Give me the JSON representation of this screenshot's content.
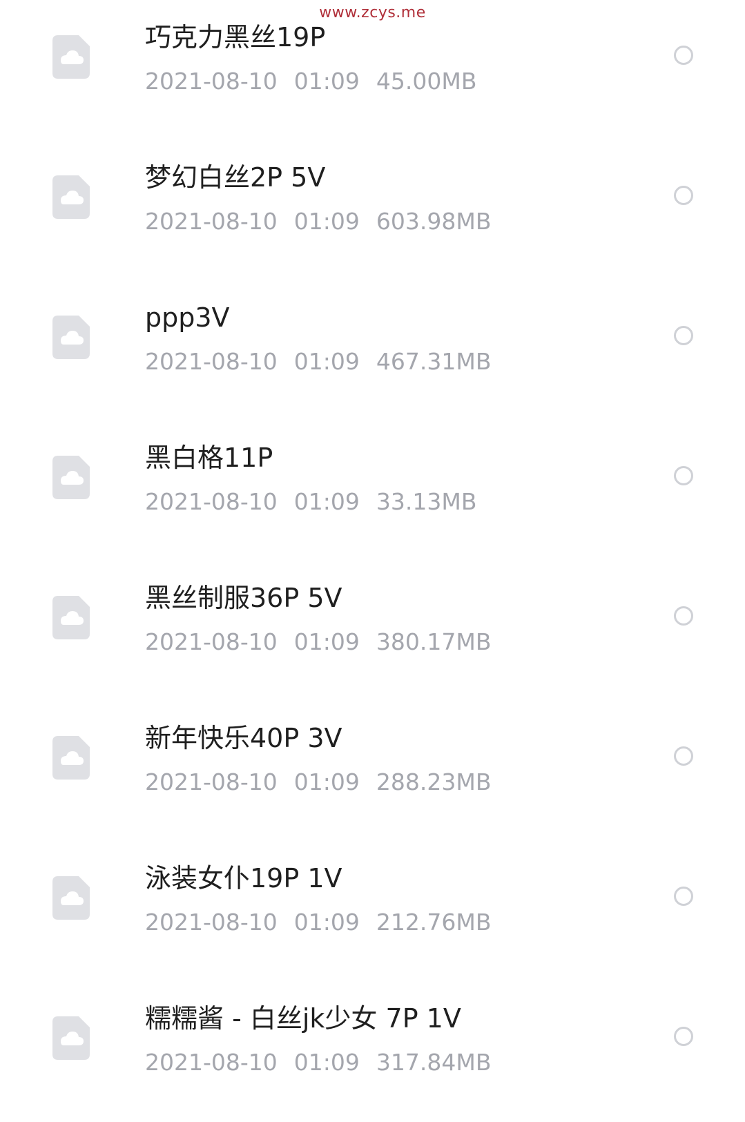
{
  "watermark": "www.zcys.me",
  "colors": {
    "background": "#ffffff",
    "title_text": "#1f1f1f",
    "meta_text": "#a4a6ad",
    "icon_fill": "#dfe0e4",
    "radio_border": "#cfd1d6",
    "watermark": "#b0303a"
  },
  "files": [
    {
      "name": "巧克力黑丝19P",
      "date": "2021-08-10",
      "time": "01:09",
      "size": "45.00MB",
      "icon": "cloud-file-icon"
    },
    {
      "name": "梦幻白丝2P 5V",
      "date": "2021-08-10",
      "time": "01:09",
      "size": "603.98MB",
      "icon": "cloud-file-icon"
    },
    {
      "name": "ppp3V",
      "date": "2021-08-10",
      "time": "01:09",
      "size": "467.31MB",
      "icon": "cloud-file-icon"
    },
    {
      "name": "黑白格11P",
      "date": "2021-08-10",
      "time": "01:09",
      "size": "33.13MB",
      "icon": "cloud-file-icon"
    },
    {
      "name": "黑丝制服36P 5V",
      "date": "2021-08-10",
      "time": "01:09",
      "size": "380.17MB",
      "icon": "cloud-file-icon"
    },
    {
      "name": "新年快乐40P 3V",
      "date": "2021-08-10",
      "time": "01:09",
      "size": "288.23MB",
      "icon": "cloud-file-icon"
    },
    {
      "name": "泳装女仆19P 1V",
      "date": "2021-08-10",
      "time": "01:09",
      "size": "212.76MB",
      "icon": "cloud-file-icon"
    },
    {
      "name": "糯糯酱 - 白丝jk少女 7P 1V",
      "date": "2021-08-10",
      "time": "01:09",
      "size": "317.84MB",
      "icon": "cloud-file-icon"
    }
  ]
}
